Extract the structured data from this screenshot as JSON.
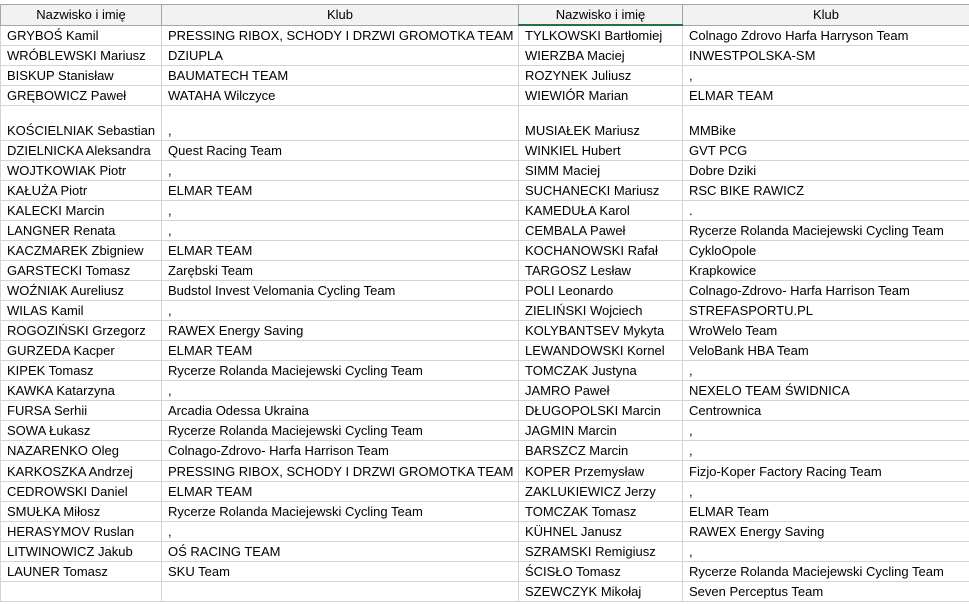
{
  "headers": [
    "Nazwisko i imię",
    "Klub",
    "Nazwisko i imię",
    "Klub"
  ],
  "rows": [
    {
      "n1": "GRYBOŚ Kamil",
      "k1": "PRESSING RIBOX, SCHODY I DRZWI GROMOTKA TEAM",
      "n2": "TYLKOWSKI Bartłomiej",
      "k2": "Colnago Zdrovo Harfa Harryson Team"
    },
    {
      "n1": "WRÓBLEWSKI Mariusz",
      "k1": "DZIUPLA",
      "n2": "WIERZBA Maciej",
      "k2": "INWESTPOLSKA-SM"
    },
    {
      "n1": "BISKUP Stanisław",
      "k1": "BAUMATECH TEAM",
      "n2": "ROZYNEK Juliusz",
      "k2": ","
    },
    {
      "n1": "GRĘBOWICZ Paweł",
      "k1": "WATAHA Wilczyce",
      "n2": "WIEWIÓR Marian",
      "k2": "ELMAR TEAM"
    },
    {
      "n1": "KOŚCIELNIAK Sebastian",
      "k1": ",",
      "n2": "MUSIAŁEK Mariusz",
      "k2": "MMBike"
    },
    {
      "n1": "DZIELNICKA Aleksandra",
      "k1": "Quest Racing Team",
      "n2": "WINKIEL Hubert",
      "k2": "GVT PCG"
    },
    {
      "n1": "WOJTKOWIAK Piotr",
      "k1": ",",
      "n2": "SIMM Maciej",
      "k2": "Dobre Dziki"
    },
    {
      "n1": "KAŁUŻA Piotr",
      "k1": "ELMAR TEAM",
      "n2": "SUCHANECKI Mariusz",
      "k2": "RSC BIKE RAWICZ"
    },
    {
      "n1": "KALECKI Marcin",
      "k1": ",",
      "n2": "KAMEDUŁA Karol",
      "k2": "."
    },
    {
      "n1": "LANGNER Renata",
      "k1": ",",
      "n2": "CEMBALA Paweł",
      "k2": "Rycerze Rolanda Maciejewski Cycling Team"
    },
    {
      "n1": "KACZMAREK Zbigniew",
      "k1": "ELMAR TEAM",
      "n2": "KOCHANOWSKI Rafał",
      "k2": "CykloOpole"
    },
    {
      "n1": "GARSTECKI Tomasz",
      "k1": "Zarębski Team",
      "n2": "TARGOSZ Lesław",
      "k2": "Krapkowice"
    },
    {
      "n1": "WOŹNIAK Aureliusz",
      "k1": "Budstol Invest Velomania Cycling Team",
      "n2": "POLI Leonardo",
      "k2": "Colnago-Zdrovo- Harfa Harrison Team"
    },
    {
      "n1": "WILAS Kamil",
      "k1": ",",
      "n2": "ZIELIŃSKI Wojciech",
      "k2": "STREFASPORTU.PL"
    },
    {
      "n1": "ROGOZIŃSKI Grzegorz",
      "k1": "RAWEX Energy Saving",
      "n2": "KOLYBANTSEV Mykyta",
      "k2": "WroWelo Team"
    },
    {
      "n1": "GURZEDA Kacper",
      "k1": "ELMAR TEAM",
      "n2": "LEWANDOWSKI Kornel",
      "k2": "VeloBank HBA Team"
    },
    {
      "n1": "KIPEK Tomasz",
      "k1": "Rycerze Rolanda Maciejewski Cycling Team",
      "n2": "TOMCZAK Justyna",
      "k2": ","
    },
    {
      "n1": "KAWKA Katarzyna",
      "k1": ",",
      "n2": "JAMRO Paweł",
      "k2": "NEXELO TEAM ŚWIDNICA"
    },
    {
      "n1": "FURSA Serhii",
      "k1": "Arcadia Odessa Ukraina",
      "n2": "DŁUGOPOLSKI Marcin",
      "k2": "Centrownica"
    },
    {
      "n1": "SOWA Łukasz",
      "k1": "Rycerze Rolanda Maciejewski Cycling Team",
      "n2": "JAGMIN Marcin",
      "k2": ","
    },
    {
      "n1": "NAZARENKO Oleg",
      "k1": "Colnago-Zdrovo- Harfa Harrison Team",
      "n2": "BARSZCZ Marcin",
      "k2": ","
    },
    {
      "n1": "KARKOSZKA Andrzej",
      "k1": "PRESSING RIBOX, SCHODY I DRZWI GROMOTKA TEAM",
      "n2": "KOPER Przemysław",
      "k2": "Fizjo-Koper Factory Racing Team"
    },
    {
      "n1": "CEDROWSKI Daniel",
      "k1": "ELMAR TEAM",
      "n2": "ZAKLUKIEWICZ Jerzy",
      "k2": ","
    },
    {
      "n1": "SMUŁKA Miłosz",
      "k1": "Rycerze Rolanda Maciejewski Cycling Team",
      "n2": "TOMCZAK Tomasz",
      "k2": "ELMAR Team"
    },
    {
      "n1": "HERASYMOV Ruslan",
      "k1": ",",
      "n2": "KÜHNEL Janusz",
      "k2": "RAWEX Energy Saving"
    },
    {
      "n1": "LITWINOWICZ Jakub",
      "k1": "OŚ RACING TEAM",
      "n2": "SZRAMSKI Remigiusz",
      "k2": ","
    },
    {
      "n1": "LAUNER Tomasz",
      "k1": "SKU Team",
      "n2": "ŚCISŁO Tomasz",
      "k2": "Rycerze Rolanda Maciejewski Cycling Team"
    },
    {
      "n1": "",
      "k1": "",
      "n2": "SZEWCZYK Mikołaj",
      "k2": "Seven Perceptus Team"
    }
  ]
}
